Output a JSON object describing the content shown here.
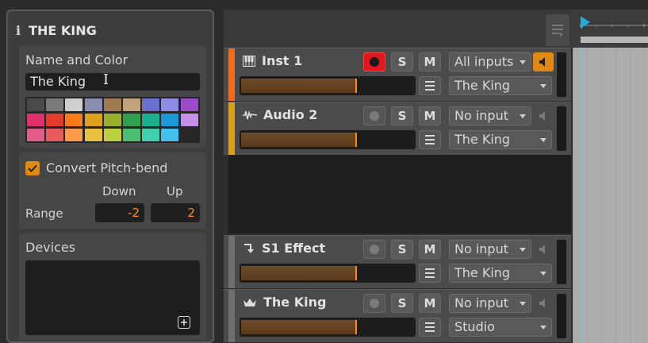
{
  "inspector": {
    "title": "THE KING",
    "name_color_label": "Name and Color",
    "name_value": "The King",
    "palette": [
      [
        "#4a4a4a",
        "#7a7a7a",
        "#cfcfcf",
        "#8a8fb0",
        "#a07a50",
        "#c4a27a",
        "#6b6fd0",
        "#8e8ee6",
        "#9a4cc8"
      ],
      [
        "#e0306a",
        "#e63a2a",
        "#ff7a1a",
        "#e0a020",
        "#98b028",
        "#30a050",
        "#18b090",
        "#1c98d8",
        "#c490e8"
      ],
      [
        "#e05c8a",
        "#e85c5c",
        "#ff9a4a",
        "#e8c040",
        "#bcd040",
        "#4cc070",
        "#40d0b0",
        "#44c0f0",
        null
      ]
    ],
    "pitch_bend": {
      "checkbox_label": "Convert Pitch-bend",
      "down_label": "Down",
      "up_label": "Up",
      "range_label": "Range",
      "down_value": "-2",
      "up_value": "2",
      "checked": true
    },
    "devices": {
      "label": "Devices"
    }
  },
  "tracks": [
    {
      "name": "Inst 1",
      "icon": "piano-icon",
      "color": "#f26b1d",
      "input": "All inputs",
      "output": "The King",
      "rec_armed": true,
      "monitor_on": true
    },
    {
      "name": "Audio 2",
      "icon": "waveform-icon",
      "color": "#d9a11a",
      "input": "No input",
      "output": "The King",
      "rec_armed": false,
      "monitor_on": false
    },
    {
      "name": "S1 Effect",
      "icon": "return-arrow-icon",
      "color": "#6e6e6e",
      "input": "No input",
      "output": "The King",
      "rec_armed": false,
      "monitor_on": false
    },
    {
      "name": "The King",
      "icon": "crown-icon",
      "color": "#6e6e6e",
      "input": "No input",
      "output": "Studio",
      "rec_armed": false,
      "monitor_on": false
    }
  ],
  "buttons": {
    "solo": "S",
    "mute": "M"
  },
  "colors": {
    "accent": "#ff8a12",
    "record": "#e2161e"
  }
}
